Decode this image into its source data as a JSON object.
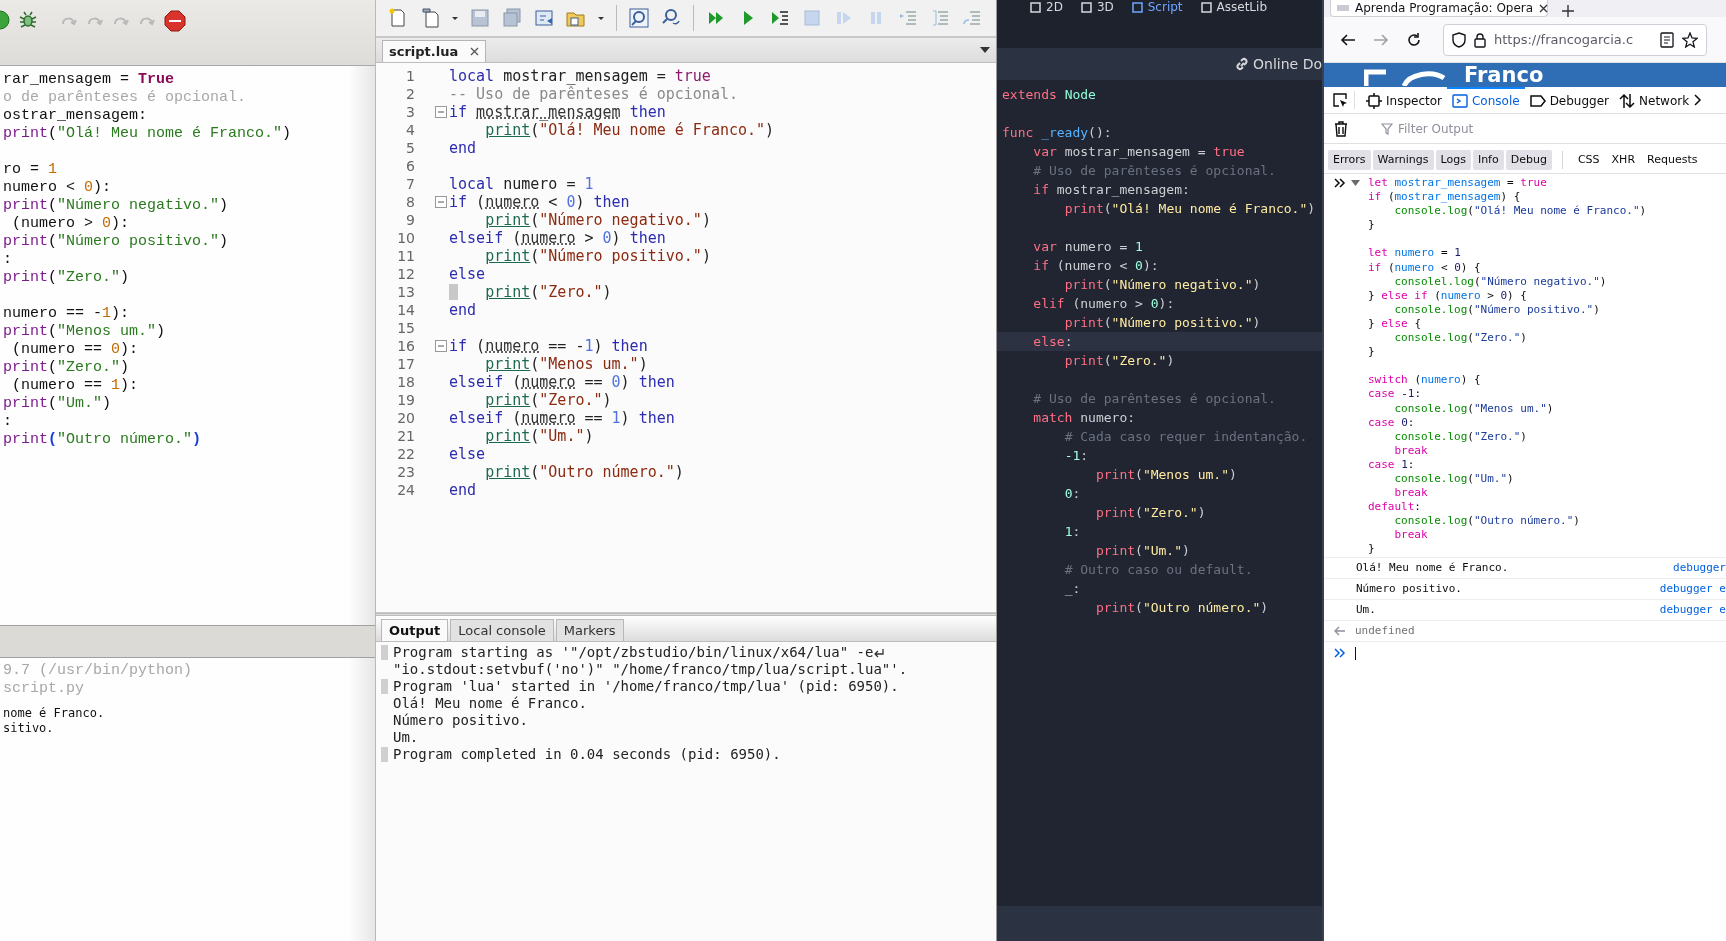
{
  "python_ide": {
    "code_lines": [
      {
        "kind": "code",
        "segs": [
          {
            "kind": "p",
            "text": "rar_mensagem = "
          },
          {
            "kind": "kw",
            "text": "True"
          }
        ]
      },
      {
        "kind": "code",
        "segs": [
          {
            "kind": "cm",
            "text": "o de parênteses é opcional."
          }
        ]
      },
      {
        "kind": "code",
        "segs": [
          {
            "kind": "p",
            "text": "ostrar_mensagem:"
          }
        ]
      },
      {
        "kind": "code",
        "segs": [
          {
            "kind": "fn",
            "text": "print"
          },
          {
            "kind": "p",
            "text": "("
          },
          {
            "kind": "str",
            "text": "\"Olá! Meu nome é Franco.\""
          },
          {
            "kind": "p",
            "text": ")"
          }
        ]
      },
      {
        "kind": "blank"
      },
      {
        "kind": "code",
        "segs": [
          {
            "kind": "p",
            "text": "ro = "
          },
          {
            "kind": "num",
            "text": "1"
          }
        ]
      },
      {
        "kind": "code",
        "segs": [
          {
            "kind": "p",
            "text": "numero < "
          },
          {
            "kind": "num",
            "text": "0"
          },
          {
            "kind": "p",
            "text": "):"
          }
        ]
      },
      {
        "kind": "code",
        "segs": [
          {
            "kind": "fn",
            "text": "print"
          },
          {
            "kind": "p",
            "text": "("
          },
          {
            "kind": "str",
            "text": "\"Número negativo.\""
          },
          {
            "kind": "p",
            "text": ")"
          }
        ]
      },
      {
        "kind": "code",
        "segs": [
          {
            "kind": "p",
            "text": " (numero > "
          },
          {
            "kind": "num",
            "text": "0"
          },
          {
            "kind": "p",
            "text": "):"
          }
        ]
      },
      {
        "kind": "code",
        "segs": [
          {
            "kind": "fn",
            "text": "print"
          },
          {
            "kind": "p",
            "text": "("
          },
          {
            "kind": "str",
            "text": "\"Número positivo.\""
          },
          {
            "kind": "p",
            "text": ")"
          }
        ]
      },
      {
        "kind": "code",
        "segs": [
          {
            "kind": "p",
            "text": ":"
          }
        ]
      },
      {
        "kind": "code",
        "segs": [
          {
            "kind": "fn",
            "text": "print"
          },
          {
            "kind": "p",
            "text": "("
          },
          {
            "kind": "str",
            "text": "\"Zero.\""
          },
          {
            "kind": "p",
            "text": ")"
          }
        ]
      },
      {
        "kind": "blank"
      },
      {
        "kind": "code",
        "segs": [
          {
            "kind": "p",
            "text": "numero == -"
          },
          {
            "kind": "num",
            "text": "1"
          },
          {
            "kind": "p",
            "text": "):"
          }
        ]
      },
      {
        "kind": "code",
        "segs": [
          {
            "kind": "fn",
            "text": "print"
          },
          {
            "kind": "p",
            "text": "("
          },
          {
            "kind": "str",
            "text": "\"Menos um.\""
          },
          {
            "kind": "p",
            "text": ")"
          }
        ]
      },
      {
        "kind": "code",
        "segs": [
          {
            "kind": "p",
            "text": " (numero == "
          },
          {
            "kind": "num",
            "text": "0"
          },
          {
            "kind": "p",
            "text": "):"
          }
        ]
      },
      {
        "kind": "code",
        "segs": [
          {
            "kind": "fn",
            "text": "print"
          },
          {
            "kind": "p",
            "text": "("
          },
          {
            "kind": "str",
            "text": "\"Zero.\""
          },
          {
            "kind": "p",
            "text": ")"
          }
        ]
      },
      {
        "kind": "code",
        "segs": [
          {
            "kind": "p",
            "text": " (numero == "
          },
          {
            "kind": "num",
            "text": "1"
          },
          {
            "kind": "p",
            "text": "):"
          }
        ]
      },
      {
        "kind": "code",
        "segs": [
          {
            "kind": "fn",
            "text": "print"
          },
          {
            "kind": "p",
            "text": "("
          },
          {
            "kind": "str",
            "text": "\"Um.\""
          },
          {
            "kind": "p",
            "text": ")"
          }
        ]
      },
      {
        "kind": "code",
        "segs": [
          {
            "kind": "p",
            "text": ":"
          }
        ]
      },
      {
        "kind": "code",
        "segs": [
          {
            "kind": "fn",
            "text": "print"
          },
          {
            "kind": "br",
            "text": "("
          },
          {
            "kind": "str",
            "text": "\"Outro número.\""
          },
          {
            "kind": "br",
            "text": ")"
          }
        ]
      }
    ],
    "output_lines": [
      {
        "kind": "info",
        "text": "9.7 (/usr/bin/python)"
      },
      {
        "kind": "info",
        "text": "script.py"
      },
      {
        "kind": "stdout",
        "text": "nome é Franco."
      },
      {
        "kind": "stdout",
        "text": "sitivo."
      }
    ]
  },
  "lua_ide": {
    "tab": {
      "label": "script.lua"
    },
    "lines": [
      {
        "number": "1",
        "fold": false,
        "current": false,
        "segs": [
          {
            "kind": "kw",
            "text": "local"
          },
          {
            "kind": "p",
            "text": " mostrar_mensagem = "
          },
          {
            "kind": "lit",
            "text": "true"
          }
        ]
      },
      {
        "number": "2",
        "fold": false,
        "current": false,
        "segs": [
          {
            "kind": "cm",
            "text": "-- Uso de parênteses é opcional."
          }
        ]
      },
      {
        "number": "3",
        "fold": true,
        "current": false,
        "segs": [
          {
            "kind": "kw",
            "text": "if"
          },
          {
            "kind": "var",
            "text": " mostrar_mensagem"
          },
          {
            "kind": "kw",
            "text": " then"
          }
        ]
      },
      {
        "number": "4",
        "fold": false,
        "current": false,
        "segs": [
          {
            "kind": "fn",
            "text": "    print"
          },
          {
            "kind": "p",
            "text": "("
          },
          {
            "kind": "str",
            "text": "\"Olá! Meu nome é Franco.\""
          },
          {
            "kind": "p",
            "text": ")"
          }
        ]
      },
      {
        "number": "5",
        "fold": false,
        "current": false,
        "segs": [
          {
            "kind": "kw",
            "text": "end"
          }
        ]
      },
      {
        "number": "6",
        "fold": false,
        "current": false
      },
      {
        "number": "7",
        "fold": false,
        "current": false,
        "segs": [
          {
            "kind": "kw",
            "text": "local"
          },
          {
            "kind": "p",
            "text": " numero = "
          },
          {
            "kind": "num",
            "text": "1"
          }
        ]
      },
      {
        "number": "8",
        "fold": true,
        "current": false,
        "segs": [
          {
            "kind": "kw",
            "text": "if"
          },
          {
            "kind": "p",
            "text": " ("
          },
          {
            "kind": "var",
            "text": "numero"
          },
          {
            "kind": "p",
            "text": " < "
          },
          {
            "kind": "num",
            "text": "0"
          },
          {
            "kind": "p",
            "text": ")"
          },
          {
            "kind": "kw",
            "text": " then"
          }
        ]
      },
      {
        "number": "9",
        "fold": false,
        "current": false,
        "segs": [
          {
            "kind": "fn",
            "text": "    print"
          },
          {
            "kind": "p",
            "text": "("
          },
          {
            "kind": "str",
            "text": "\"Número negativo.\""
          },
          {
            "kind": "p",
            "text": ")"
          }
        ]
      },
      {
        "number": "10",
        "fold": false,
        "current": false,
        "segs": [
          {
            "kind": "kw",
            "text": "elseif"
          },
          {
            "kind": "p",
            "text": " ("
          },
          {
            "kind": "var",
            "text": "numero"
          },
          {
            "kind": "p",
            "text": " > "
          },
          {
            "kind": "num",
            "text": "0"
          },
          {
            "kind": "p",
            "text": ")"
          },
          {
            "kind": "kw",
            "text": " then"
          }
        ]
      },
      {
        "number": "11",
        "fold": false,
        "current": false,
        "segs": [
          {
            "kind": "fn",
            "text": "    print"
          },
          {
            "kind": "p",
            "text": "("
          },
          {
            "kind": "str",
            "text": "\"Número positivo.\""
          },
          {
            "kind": "p",
            "text": ")"
          }
        ]
      },
      {
        "number": "12",
        "fold": false,
        "current": false,
        "segs": [
          {
            "kind": "kw",
            "text": "else"
          }
        ]
      },
      {
        "number": "13",
        "fold": false,
        "current": true,
        "segs": [
          {
            "kind": "fn",
            "text": "    print"
          },
          {
            "kind": "p",
            "text": "("
          },
          {
            "kind": "str",
            "text": "\"Zero.\""
          },
          {
            "kind": "p",
            "text": ")"
          }
        ]
      },
      {
        "number": "14",
        "fold": false,
        "current": false,
        "segs": [
          {
            "kind": "kw",
            "text": "end"
          }
        ]
      },
      {
        "number": "15",
        "fold": false,
        "current": false
      },
      {
        "number": "16",
        "fold": true,
        "current": false,
        "segs": [
          {
            "kind": "kw",
            "text": "if"
          },
          {
            "kind": "p",
            "text": " ("
          },
          {
            "kind": "var",
            "text": "numero"
          },
          {
            "kind": "p",
            "text": " == -"
          },
          {
            "kind": "num",
            "text": "1"
          },
          {
            "kind": "p",
            "text": ")"
          },
          {
            "kind": "kw",
            "text": " then"
          }
        ]
      },
      {
        "number": "17",
        "fold": false,
        "current": false,
        "segs": [
          {
            "kind": "fn",
            "text": "    print"
          },
          {
            "kind": "p",
            "text": "("
          },
          {
            "kind": "str",
            "text": "\"Menos um.\""
          },
          {
            "kind": "p",
            "text": ")"
          }
        ]
      },
      {
        "number": "18",
        "fold": false,
        "current": false,
        "segs": [
          {
            "kind": "kw",
            "text": "elseif"
          },
          {
            "kind": "p",
            "text": " ("
          },
          {
            "kind": "var",
            "text": "numero"
          },
          {
            "kind": "p",
            "text": " == "
          },
          {
            "kind": "num",
            "text": "0"
          },
          {
            "kind": "p",
            "text": ")"
          },
          {
            "kind": "kw",
            "text": " then"
          }
        ]
      },
      {
        "number": "19",
        "fold": false,
        "current": false,
        "segs": [
          {
            "kind": "fn",
            "text": "    print"
          },
          {
            "kind": "p",
            "text": "("
          },
          {
            "kind": "str",
            "text": "\"Zero.\""
          },
          {
            "kind": "p",
            "text": ")"
          }
        ]
      },
      {
        "number": "20",
        "fold": false,
        "current": false,
        "segs": [
          {
            "kind": "kw",
            "text": "elseif"
          },
          {
            "kind": "p",
            "text": " ("
          },
          {
            "kind": "var",
            "text": "numero"
          },
          {
            "kind": "p",
            "text": " == "
          },
          {
            "kind": "num",
            "text": "1"
          },
          {
            "kind": "p",
            "text": ")"
          },
          {
            "kind": "kw",
            "text": " then"
          }
        ]
      },
      {
        "number": "21",
        "fold": false,
        "current": false,
        "segs": [
          {
            "kind": "fn",
            "text": "    print"
          },
          {
            "kind": "p",
            "text": "("
          },
          {
            "kind": "str",
            "text": "\"Um.\""
          },
          {
            "kind": "p",
            "text": ")"
          }
        ]
      },
      {
        "number": "22",
        "fold": false,
        "current": false,
        "segs": [
          {
            "kind": "kw",
            "text": "else"
          }
        ]
      },
      {
        "number": "23",
        "fold": false,
        "current": false,
        "segs": [
          {
            "kind": "fn",
            "text": "    print"
          },
          {
            "kind": "p",
            "text": "("
          },
          {
            "kind": "str",
            "text": "\"Outro número.\""
          },
          {
            "kind": "p",
            "text": ")"
          }
        ]
      },
      {
        "number": "24",
        "fold": false,
        "current": false,
        "segs": [
          {
            "kind": "kw",
            "text": "end"
          }
        ]
      }
    ],
    "bottom_tabs": [
      {
        "label": "Output",
        "selected": true
      },
      {
        "label": "Local console",
        "selected": false
      },
      {
        "label": "Markers",
        "selected": false
      }
    ],
    "output": [
      {
        "marker": true,
        "wrapped": true,
        "text": "Program starting as '\"/opt/zbstudio/bin/linux/x64/lua\" -e"
      },
      {
        "marker": false,
        "wrapped": false,
        "text": "\"io.stdout:setvbuf('no')\" \"/home/franco/tmp/lua/script.lua\"'."
      },
      {
        "marker": true,
        "wrapped": false,
        "text": "Program 'lua' started in '/home/franco/tmp/lua' (pid: 6950)."
      },
      {
        "marker": false,
        "wrapped": false,
        "text": "Olá! Meu nome é Franco."
      },
      {
        "marker": false,
        "wrapped": false,
        "text": "Número positivo."
      },
      {
        "marker": false,
        "wrapped": false,
        "text": "Um."
      },
      {
        "marker": true,
        "wrapped": false,
        "text": "Program completed in 0.04 seconds (pid: 6950)."
      }
    ]
  },
  "godot": {
    "top_tabs": [
      {
        "label": "2D",
        "selected": false
      },
      {
        "label": "3D",
        "selected": false
      },
      {
        "label": "Script",
        "selected": true
      },
      {
        "label": "AssetLib",
        "selected": false
      }
    ],
    "online_docs": "Online Do",
    "lines": [
      {
        "kind": "code",
        "highlighted": false,
        "segs": [
          {
            "kind": "kw",
            "text": "extends"
          },
          {
            "kind": "cls",
            "text": " Node"
          }
        ]
      },
      {
        "kind": "blank",
        "highlighted": false
      },
      {
        "kind": "code",
        "highlighted": false,
        "segs": [
          {
            "kind": "kw",
            "text": "func"
          },
          {
            "kind": "fnm",
            "text": " _ready"
          },
          {
            "kind": "p",
            "text": "():"
          }
        ]
      },
      {
        "kind": "code",
        "highlighted": false,
        "segs": [
          {
            "kind": "kw",
            "text": "    var"
          },
          {
            "kind": "p",
            "text": " mostrar_mensagem = "
          },
          {
            "kind": "kw",
            "text": "true"
          }
        ]
      },
      {
        "kind": "code",
        "highlighted": false,
        "segs": [
          {
            "kind": "cm",
            "text": "    # Uso de parênteses é opcional."
          }
        ]
      },
      {
        "kind": "code",
        "highlighted": false,
        "segs": [
          {
            "kind": "kw",
            "text": "    if"
          },
          {
            "kind": "p",
            "text": " mostrar_mensagem:"
          }
        ]
      },
      {
        "kind": "code",
        "highlighted": false,
        "segs": [
          {
            "kind": "kw",
            "text": "        print"
          },
          {
            "kind": "p",
            "text": "("
          },
          {
            "kind": "str",
            "text": "\"Olá! Meu nome é Franco.\""
          },
          {
            "kind": "p",
            "text": ")"
          }
        ]
      },
      {
        "kind": "blank",
        "highlighted": false
      },
      {
        "kind": "code",
        "highlighted": false,
        "segs": [
          {
            "kind": "kw",
            "text": "    var"
          },
          {
            "kind": "p",
            "text": " numero = "
          },
          {
            "kind": "num",
            "text": "1"
          }
        ]
      },
      {
        "kind": "code",
        "highlighted": false,
        "segs": [
          {
            "kind": "kw",
            "text": "    if"
          },
          {
            "kind": "p",
            "text": " (numero < "
          },
          {
            "kind": "num",
            "text": "0"
          },
          {
            "kind": "p",
            "text": "):"
          }
        ]
      },
      {
        "kind": "code",
        "highlighted": false,
        "segs": [
          {
            "kind": "kw",
            "text": "        print"
          },
          {
            "kind": "p",
            "text": "("
          },
          {
            "kind": "str",
            "text": "\"Número negativo.\""
          },
          {
            "kind": "p",
            "text": ")"
          }
        ]
      },
      {
        "kind": "code",
        "highlighted": false,
        "segs": [
          {
            "kind": "kw",
            "text": "    elif"
          },
          {
            "kind": "p",
            "text": " (numero > "
          },
          {
            "kind": "num",
            "text": "0"
          },
          {
            "kind": "p",
            "text": "):"
          }
        ]
      },
      {
        "kind": "code",
        "highlighted": false,
        "segs": [
          {
            "kind": "kw",
            "text": "        print"
          },
          {
            "kind": "p",
            "text": "("
          },
          {
            "kind": "str",
            "text": "\"Número positivo.\""
          },
          {
            "kind": "p",
            "text": ")"
          }
        ]
      },
      {
        "kind": "code",
        "highlighted": true,
        "segs": [
          {
            "kind": "kw",
            "text": "    else"
          },
          {
            "kind": "p",
            "text": ":"
          }
        ]
      },
      {
        "kind": "code",
        "highlighted": false,
        "segs": [
          {
            "kind": "kw",
            "text": "        print"
          },
          {
            "kind": "p",
            "text": "("
          },
          {
            "kind": "str",
            "text": "\"Zero.\""
          },
          {
            "kind": "p",
            "text": ")"
          }
        ]
      },
      {
        "kind": "blank",
        "highlighted": false
      },
      {
        "kind": "code",
        "highlighted": false,
        "segs": [
          {
            "kind": "cm",
            "text": "    # Uso de parênteses é opcional."
          }
        ]
      },
      {
        "kind": "code",
        "highlighted": false,
        "segs": [
          {
            "kind": "kw",
            "text": "    match"
          },
          {
            "kind": "p",
            "text": " numero:"
          }
        ]
      },
      {
        "kind": "code",
        "highlighted": false,
        "segs": [
          {
            "kind": "cm",
            "text": "        # Cada caso requer indentanção."
          }
        ]
      },
      {
        "kind": "code",
        "highlighted": false,
        "segs": [
          {
            "kind": "num",
            "text": "        -1"
          },
          {
            "kind": "p",
            "text": ":"
          }
        ]
      },
      {
        "kind": "code",
        "highlighted": false,
        "segs": [
          {
            "kind": "kw",
            "text": "            print"
          },
          {
            "kind": "p",
            "text": "("
          },
          {
            "kind": "str",
            "text": "\"Menos um.\""
          },
          {
            "kind": "p",
            "text": ")"
          }
        ]
      },
      {
        "kind": "code",
        "highlighted": false,
        "segs": [
          {
            "kind": "num",
            "text": "        0"
          },
          {
            "kind": "p",
            "text": ":"
          }
        ]
      },
      {
        "kind": "code",
        "highlighted": false,
        "segs": [
          {
            "kind": "kw",
            "text": "            print"
          },
          {
            "kind": "p",
            "text": "("
          },
          {
            "kind": "str",
            "text": "\"Zero.\""
          },
          {
            "kind": "p",
            "text": ")"
          }
        ]
      },
      {
        "kind": "code",
        "highlighted": false,
        "segs": [
          {
            "kind": "num",
            "text": "        1"
          },
          {
            "kind": "p",
            "text": ":"
          }
        ]
      },
      {
        "kind": "code",
        "highlighted": false,
        "segs": [
          {
            "kind": "kw",
            "text": "            print"
          },
          {
            "kind": "p",
            "text": "("
          },
          {
            "kind": "str",
            "text": "\"Um.\""
          },
          {
            "kind": "p",
            "text": ")"
          }
        ]
      },
      {
        "kind": "code",
        "highlighted": false,
        "segs": [
          {
            "kind": "cm",
            "text": "        # Outro caso ou default."
          }
        ]
      },
      {
        "kind": "code",
        "highlighted": false,
        "segs": [
          {
            "kind": "p",
            "text": "        _:"
          }
        ]
      },
      {
        "kind": "code",
        "highlighted": false,
        "segs": [
          {
            "kind": "kw",
            "text": "            print"
          },
          {
            "kind": "p",
            "text": "("
          },
          {
            "kind": "str",
            "text": "\"Outro número.\""
          },
          {
            "kind": "p",
            "text": ")"
          }
        ]
      }
    ]
  },
  "browser": {
    "tab_title": "Aprenda Programação: Opera",
    "url": "https://francogarcia.c",
    "banner_text": "Franco",
    "devtools_tabs": [
      {
        "label": "Inspector",
        "selected": false
      },
      {
        "label": "Console",
        "selected": true
      },
      {
        "label": "Debugger",
        "selected": false
      },
      {
        "label": "Network",
        "selected": false
      }
    ],
    "filter_placeholder": "Filter Output",
    "filters": [
      {
        "label": "Errors",
        "on": true
      },
      {
        "label": "Warnings",
        "on": true
      },
      {
        "label": "Logs",
        "on": true
      },
      {
        "label": "Info",
        "on": true
      },
      {
        "label": "Debug",
        "on": true
      },
      {
        "label": "CSS",
        "on": false
      },
      {
        "label": "XHR",
        "on": false
      },
      {
        "label": "Requests",
        "on": false
      }
    ],
    "input_lines": [
      {
        "kind": "code",
        "segs": [
          {
            "kind": "kw",
            "text": "let"
          },
          {
            "kind": "var",
            "text": " mostrar_mensagem"
          },
          {
            "kind": "p",
            "text": " = "
          },
          {
            "kind": "kw",
            "text": "true"
          }
        ]
      },
      {
        "kind": "code",
        "segs": [
          {
            "kind": "kw",
            "text": "if"
          },
          {
            "kind": "p",
            "text": " ("
          },
          {
            "kind": "var",
            "text": "mostrar_mensagem"
          },
          {
            "kind": "p",
            "text": ") {"
          }
        ]
      },
      {
        "kind": "code",
        "segs": [
          {
            "kind": "fn",
            "text": "    console.log"
          },
          {
            "kind": "p",
            "text": "("
          },
          {
            "kind": "str",
            "text": "\"Olá! Meu nome é Franco.\""
          },
          {
            "kind": "p",
            "text": ")"
          }
        ]
      },
      {
        "kind": "code",
        "segs": [
          {
            "kind": "p",
            "text": "}"
          }
        ]
      },
      {
        "kind": "blank"
      },
      {
        "kind": "code",
        "segs": [
          {
            "kind": "kw",
            "text": "let"
          },
          {
            "kind": "var",
            "text": " numero"
          },
          {
            "kind": "p",
            "text": " = "
          },
          {
            "kind": "num",
            "text": "1"
          }
        ]
      },
      {
        "kind": "code",
        "segs": [
          {
            "kind": "kw",
            "text": "if"
          },
          {
            "kind": "p",
            "text": " ("
          },
          {
            "kind": "var",
            "text": "numero"
          },
          {
            "kind": "p",
            "text": " < "
          },
          {
            "kind": "num",
            "text": "0"
          },
          {
            "kind": "p",
            "text": ") {"
          }
        ]
      },
      {
        "kind": "code",
        "segs": [
          {
            "kind": "fn",
            "text": "    consolel.log"
          },
          {
            "kind": "p",
            "text": "("
          },
          {
            "kind": "str",
            "text": "\"Número negativo.\""
          },
          {
            "kind": "p",
            "text": ")"
          }
        ]
      },
      {
        "kind": "code",
        "segs": [
          {
            "kind": "p",
            "text": "}"
          },
          {
            "kind": "kw",
            "text": " else if"
          },
          {
            "kind": "p",
            "text": " ("
          },
          {
            "kind": "var",
            "text": "numero"
          },
          {
            "kind": "p",
            "text": " > "
          },
          {
            "kind": "num",
            "text": "0"
          },
          {
            "kind": "p",
            "text": ") {"
          }
        ]
      },
      {
        "kind": "code",
        "segs": [
          {
            "kind": "fn",
            "text": "    console.log"
          },
          {
            "kind": "p",
            "text": "("
          },
          {
            "kind": "str",
            "text": "\"Número positivo.\""
          },
          {
            "kind": "p",
            "text": ")"
          }
        ]
      },
      {
        "kind": "code",
        "segs": [
          {
            "kind": "p",
            "text": "}"
          },
          {
            "kind": "kw",
            "text": " else"
          },
          {
            "kind": "p",
            "text": " {"
          }
        ]
      },
      {
        "kind": "code",
        "segs": [
          {
            "kind": "fn",
            "text": "    console.log"
          },
          {
            "kind": "p",
            "text": "("
          },
          {
            "kind": "str",
            "text": "\"Zero.\""
          },
          {
            "kind": "p",
            "text": ")"
          }
        ]
      },
      {
        "kind": "code",
        "segs": [
          {
            "kind": "p",
            "text": "}"
          }
        ]
      },
      {
        "kind": "blank"
      },
      {
        "kind": "code",
        "segs": [
          {
            "kind": "kw",
            "text": "switch"
          },
          {
            "kind": "p",
            "text": " ("
          },
          {
            "kind": "var",
            "text": "numero"
          },
          {
            "kind": "p",
            "text": ") {"
          }
        ]
      },
      {
        "kind": "code",
        "segs": [
          {
            "kind": "kw",
            "text": "case"
          },
          {
            "kind": "p",
            "text": " -"
          },
          {
            "kind": "num",
            "text": "1"
          },
          {
            "kind": "p",
            "text": ":"
          }
        ]
      },
      {
        "kind": "code",
        "segs": [
          {
            "kind": "fn",
            "text": "    console.log"
          },
          {
            "kind": "p",
            "text": "("
          },
          {
            "kind": "str",
            "text": "\"Menos um.\""
          },
          {
            "kind": "p",
            "text": ")"
          }
        ]
      },
      {
        "kind": "code",
        "segs": [
          {
            "kind": "kw",
            "text": "case"
          },
          {
            "kind": "num",
            "text": " 0"
          },
          {
            "kind": "p",
            "text": ":"
          }
        ]
      },
      {
        "kind": "code",
        "segs": [
          {
            "kind": "fn",
            "text": "    console.log"
          },
          {
            "kind": "p",
            "text": "("
          },
          {
            "kind": "str",
            "text": "\"Zero.\""
          },
          {
            "kind": "p",
            "text": ")"
          }
        ]
      },
      {
        "kind": "code",
        "segs": [
          {
            "kind": "kw",
            "text": "    break"
          }
        ]
      },
      {
        "kind": "code",
        "segs": [
          {
            "kind": "kw",
            "text": "case"
          },
          {
            "kind": "num",
            "text": " 1"
          },
          {
            "kind": "p",
            "text": ":"
          }
        ]
      },
      {
        "kind": "code",
        "segs": [
          {
            "kind": "fn",
            "text": "    console.log"
          },
          {
            "kind": "p",
            "text": "("
          },
          {
            "kind": "str",
            "text": "\"Um.\""
          },
          {
            "kind": "p",
            "text": ")"
          }
        ]
      },
      {
        "kind": "code",
        "segs": [
          {
            "kind": "kw",
            "text": "    break"
          }
        ]
      },
      {
        "kind": "code",
        "segs": [
          {
            "kind": "kw",
            "text": "default"
          },
          {
            "kind": "p",
            "text": ":"
          }
        ]
      },
      {
        "kind": "code",
        "segs": [
          {
            "kind": "fn",
            "text": "    console.log"
          },
          {
            "kind": "p",
            "text": "("
          },
          {
            "kind": "str",
            "text": "\"Outro número.\""
          },
          {
            "kind": "p",
            "text": ")"
          }
        ]
      },
      {
        "kind": "code",
        "segs": [
          {
            "kind": "kw",
            "text": "    break"
          }
        ]
      },
      {
        "kind": "code",
        "segs": [
          {
            "kind": "p",
            "text": "}"
          }
        ]
      }
    ],
    "messages": [
      {
        "text": "Olá! Meu nome é Franco.",
        "source": "debugger"
      },
      {
        "text": "Número positivo.",
        "source": "debugger e"
      },
      {
        "text": "Um.",
        "source": "debugger e"
      }
    ],
    "result": "undefined"
  }
}
